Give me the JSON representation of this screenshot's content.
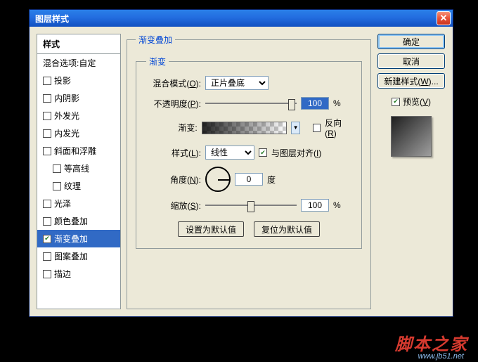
{
  "title": "图层样式",
  "sidebar": {
    "header": "样式",
    "items": [
      {
        "label": "混合选项:自定",
        "checkbox": false
      },
      {
        "label": "投影",
        "checkbox": true,
        "checked": false
      },
      {
        "label": "内阴影",
        "checkbox": true,
        "checked": false
      },
      {
        "label": "外发光",
        "checkbox": true,
        "checked": false
      },
      {
        "label": "内发光",
        "checkbox": true,
        "checked": false
      },
      {
        "label": "斜面和浮雕",
        "checkbox": true,
        "checked": false
      },
      {
        "label": "等高线",
        "checkbox": true,
        "checked": false,
        "sub": true
      },
      {
        "label": "纹理",
        "checkbox": true,
        "checked": false,
        "sub": true
      },
      {
        "label": "光泽",
        "checkbox": true,
        "checked": false
      },
      {
        "label": "颜色叠加",
        "checkbox": true,
        "checked": false
      },
      {
        "label": "渐变叠加",
        "checkbox": true,
        "checked": true,
        "selected": true
      },
      {
        "label": "图案叠加",
        "checkbox": true,
        "checked": false
      },
      {
        "label": "描边",
        "checkbox": true,
        "checked": false
      }
    ]
  },
  "main": {
    "group_title": "渐变叠加",
    "inner_title": "渐变",
    "blend_mode_label": "混合模式(",
    "blend_mode_key": "O",
    "label_close": "):",
    "blend_mode_value": "正片叠底",
    "opacity_label": "不透明度(",
    "opacity_key": "P",
    "opacity_value": "100",
    "percent": "%",
    "gradient_label": "渐变:",
    "reverse_label": "反向(",
    "reverse_key": "R",
    "reverse_close": ")",
    "style_label": "样式(",
    "style_key": "L",
    "style_value": "线性",
    "align_label": "与图层对齐(",
    "align_key": "I",
    "align_close": ")",
    "angle_label": "角度(",
    "angle_key": "N",
    "angle_value": "0",
    "angle_unit": "度",
    "scale_label": "缩放(",
    "scale_key": "S",
    "scale_value": "100",
    "btn_default": "设置为默认值",
    "btn_reset": "复位为默认值"
  },
  "right": {
    "ok": "确定",
    "cancel": "取消",
    "new_style": "新建样式(",
    "new_style_key": "W",
    "new_style_close": ")...",
    "preview": "预览(",
    "preview_key": "V",
    "preview_close": ")"
  },
  "watermark": "脚本之家",
  "watermark_url": "www.jb51.net"
}
